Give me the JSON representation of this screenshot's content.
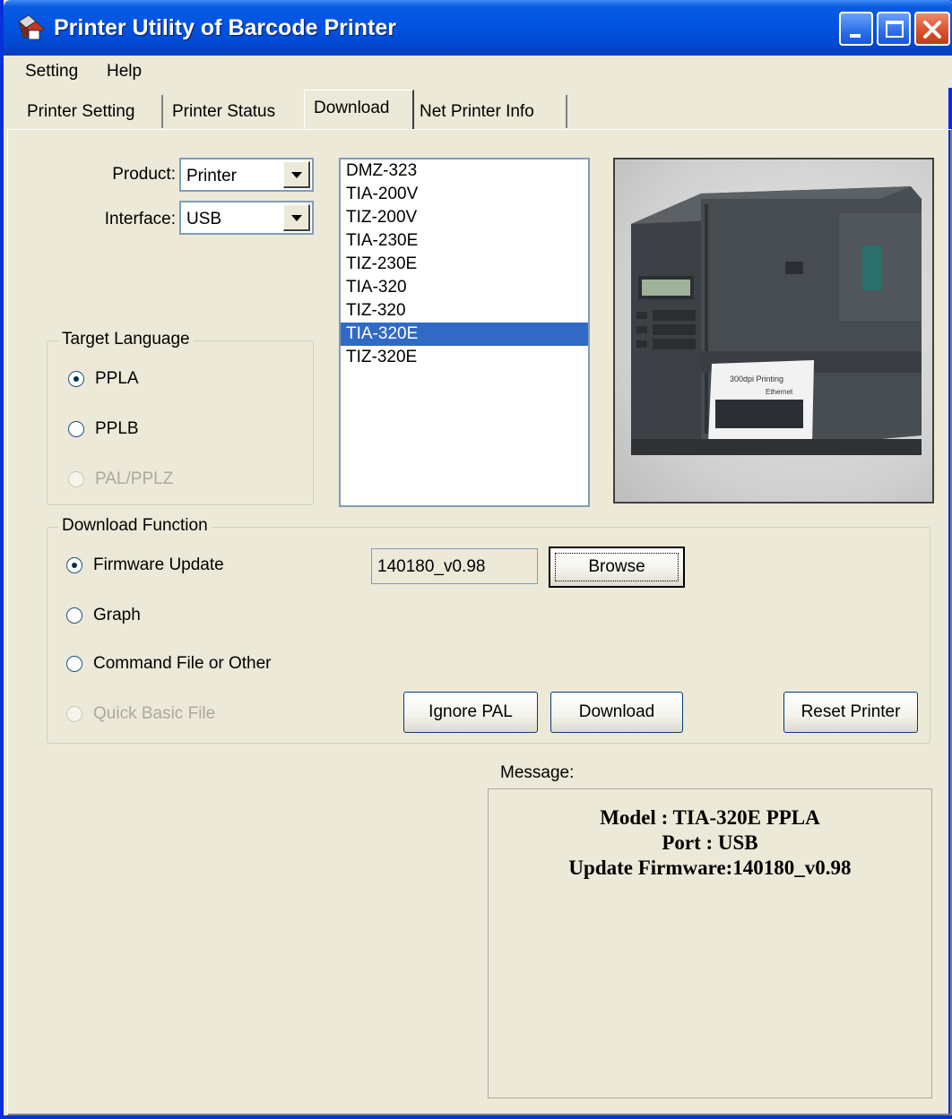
{
  "window": {
    "title": "Printer Utility of Barcode Printer",
    "icons": {
      "app": "barcode-printer-app-icon",
      "minimize": "minimize-icon",
      "maximize": "maximize-icon",
      "close": "close-icon"
    }
  },
  "menu": {
    "setting": "Setting",
    "help": "Help"
  },
  "tabs": [
    {
      "label": "Printer Setting"
    },
    {
      "label": "Printer Status"
    },
    {
      "label": "Download",
      "active": true
    },
    {
      "label": "Net Printer Info"
    }
  ],
  "form": {
    "product_label": "Product:",
    "product_value": "Printer",
    "interface_label": "Interface:",
    "interface_value": "USB"
  },
  "models": {
    "items": [
      "DMZ-323",
      "TIA-200V",
      "TIZ-200V",
      "TIA-230E",
      "TIZ-230E",
      "TIA-320",
      "TIZ-320",
      "TIA-320E",
      "TIZ-320E"
    ],
    "selected": "TIA-320E"
  },
  "target_language": {
    "title": "Target Language",
    "options": [
      {
        "label": "PPLA",
        "checked": true,
        "enabled": true
      },
      {
        "label": "PPLB",
        "checked": false,
        "enabled": true
      },
      {
        "label": "PAL/PPLZ",
        "checked": false,
        "enabled": false
      }
    ]
  },
  "download_function": {
    "title": "Download Function",
    "options": [
      {
        "label": "Firmware Update",
        "checked": true,
        "enabled": true
      },
      {
        "label": "Graph",
        "checked": false,
        "enabled": true
      },
      {
        "label": "Command File or Other",
        "checked": false,
        "enabled": true
      },
      {
        "label": "Quick Basic File",
        "checked": false,
        "enabled": false
      }
    ],
    "file_value": "140180_v0.98",
    "browse_label": "Browse",
    "ignore_pal_label": "Ignore PAL",
    "download_label": "Download",
    "reset_label": "Reset Printer"
  },
  "message": {
    "label": "Message:",
    "lines": [
      "Model : TIA-320E PPLA",
      "Port : USB",
      "Update Firmware:140180_v0.98"
    ]
  },
  "colors": {
    "titlebar": "#0054e3",
    "selection": "#316ac5",
    "dialog": "#ece9d8"
  }
}
